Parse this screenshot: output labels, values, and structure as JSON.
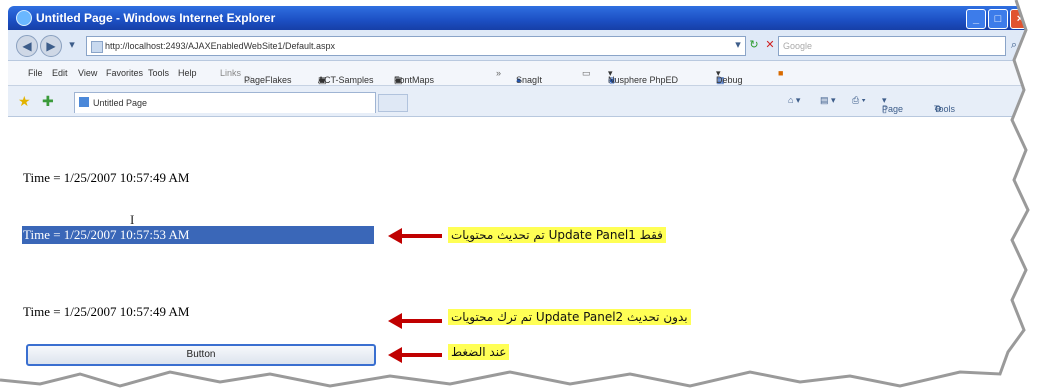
{
  "window": {
    "title": "Untitled Page - Windows Internet Explorer",
    "controls": [
      "_",
      "□",
      "×"
    ]
  },
  "addressbar": {
    "url": "http://localhost:2493/AJAXEnabledWebSite1/Default.aspx",
    "search_placeholder": "Google"
  },
  "menubar": {
    "items": [
      "File",
      "Edit",
      "View",
      "Favorites",
      "Tools",
      "Help"
    ],
    "links_label": "Links",
    "links": [
      "PageFlakes",
      "ACT-Samples",
      "FontMaps"
    ],
    "tools": [
      "SnagIt",
      "Nusphere PhpED",
      "Debug"
    ]
  },
  "tabbar": {
    "tab_title": "Untitled Page",
    "page_label": "Page",
    "tools_label": "Tools"
  },
  "content": {
    "time1": "Time = 1/25/2007 10:57:49 AM",
    "time2": "Time = 1/25/2007 10:57:53 AM",
    "time3": "Time = 1/25/2007 10:57:49 AM",
    "button_label": "Button",
    "cursor": "I"
  },
  "annotations": {
    "note1": "تم تحديث محتويات Update Panel1 فقط",
    "note2": "تم ترك محتويات Update Panel2 بدون تحديث",
    "note3": "عند الضغط"
  },
  "colors": {
    "titlebar": "#1c4fc3",
    "highlight": "#3a67b8",
    "arrow": "#c00000",
    "note_bg": "#ffff55"
  }
}
